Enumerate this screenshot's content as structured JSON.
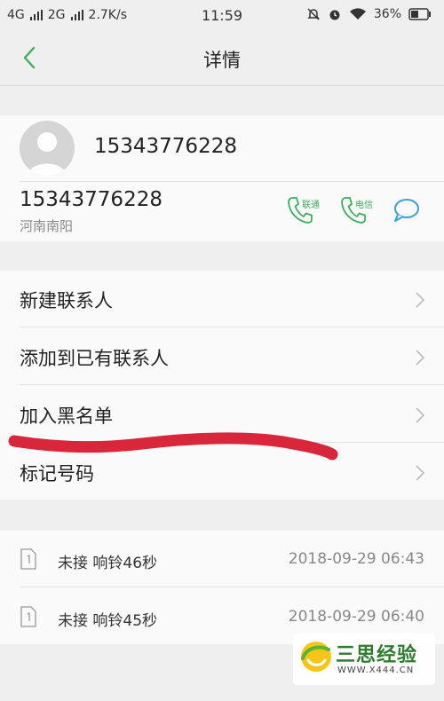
{
  "status_bar": {
    "network1": "4G",
    "network2": "2G",
    "speed": "2.7K/s",
    "time": "11:59",
    "battery": "36%",
    "icons": [
      "signal-icon",
      "mute-bell-icon",
      "alarm-icon",
      "wifi-icon",
      "battery-icon"
    ]
  },
  "nav": {
    "title": "详情",
    "back_icon": "chevron-left-icon",
    "accent_color": "#3cae5c"
  },
  "contact": {
    "name": "15343776228",
    "number": "15343776228",
    "location": "河南南阳",
    "call_unicom_label": "联通",
    "call_telecom_label": "电信",
    "icons": [
      "avatar-icon",
      "phone-icon",
      "message-icon"
    ]
  },
  "menu": {
    "items": [
      {
        "label": "新建联系人"
      },
      {
        "label": "添加到已有联系人"
      },
      {
        "label": "加入黑名单"
      },
      {
        "label": "标记号码"
      }
    ]
  },
  "history": {
    "items": [
      {
        "status": "未接 响铃46秒",
        "time": "2018-09-29 06:43"
      },
      {
        "status": "未接 响铃45秒",
        "time": "2018-09-29 06:40"
      }
    ]
  },
  "watermark": {
    "brand": "三思经验",
    "site": "WWW.X444.CN"
  },
  "colors": {
    "annotation_red": "#d8263a",
    "text_primary": "#222222",
    "text_secondary": "#888888"
  }
}
